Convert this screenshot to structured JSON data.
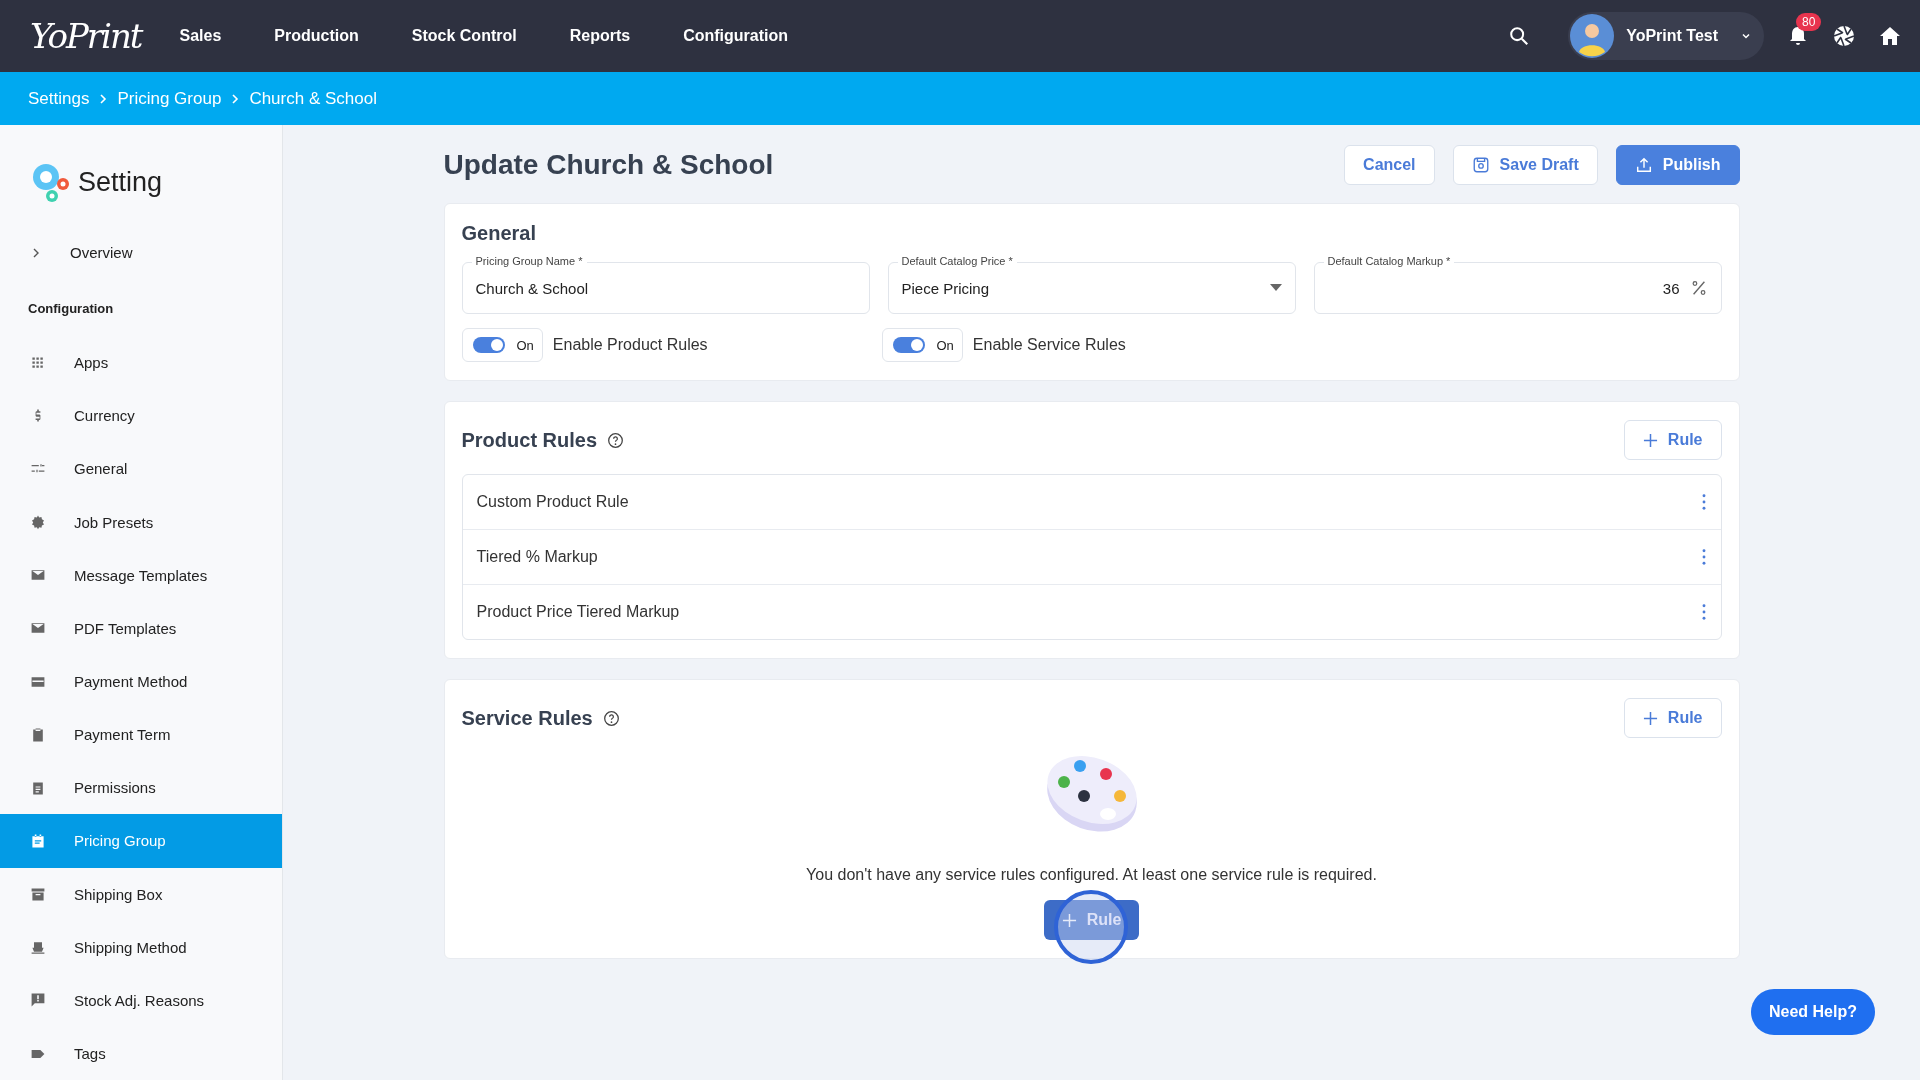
{
  "topbar": {
    "logo": "YoPrint",
    "nav": [
      {
        "label": "Sales"
      },
      {
        "label": "Production"
      },
      {
        "label": "Stock Control"
      },
      {
        "label": "Reports"
      },
      {
        "label": "Configuration"
      }
    ],
    "user": "YoPrint Test",
    "notifications": "80"
  },
  "breadcrumb": [
    "Settings",
    "Pricing Group",
    "Church & School"
  ],
  "sidebar": {
    "title": "Setting",
    "overview": "Overview",
    "section": "Configuration",
    "items": [
      {
        "label": "Apps",
        "selected": false
      },
      {
        "label": "Currency",
        "selected": false
      },
      {
        "label": "General",
        "selected": false
      },
      {
        "label": "Job Presets",
        "selected": false
      },
      {
        "label": "Message Templates",
        "selected": false
      },
      {
        "label": "PDF Templates",
        "selected": false
      },
      {
        "label": "Payment Method",
        "selected": false
      },
      {
        "label": "Payment Term",
        "selected": false
      },
      {
        "label": "Permissions",
        "selected": false
      },
      {
        "label": "Pricing Group",
        "selected": true
      },
      {
        "label": "Shipping Box",
        "selected": false
      },
      {
        "label": "Shipping Method",
        "selected": false
      },
      {
        "label": "Stock Adj. Reasons",
        "selected": false
      },
      {
        "label": "Tags",
        "selected": false
      }
    ]
  },
  "page": {
    "title": "Update Church & School",
    "buttons": [
      {
        "label": "Cancel",
        "kind": "cancel"
      },
      {
        "label": "Save Draft",
        "kind": "draft"
      },
      {
        "label": "Publish",
        "kind": "publish"
      }
    ]
  },
  "general": {
    "title": "General",
    "fields": [
      {
        "kind": "text",
        "label": "Pricing Group Name *",
        "value": "Church & School"
      },
      {
        "kind": "select",
        "label": "Default Catalog Price *",
        "value": "Piece Pricing"
      },
      {
        "kind": "percent",
        "label": "Default Catalog Markup *",
        "value": "36"
      }
    ],
    "toggles": [
      {
        "state": "On",
        "on": true,
        "label": "Enable Product Rules"
      },
      {
        "state": "On",
        "on": true,
        "label": "Enable Service Rules"
      }
    ]
  },
  "product_rules": {
    "title": "Product Rules",
    "add": "Rule",
    "rules": [
      "Custom Product Rule",
      "Tiered % Markup",
      "Product Price Tiered Markup"
    ]
  },
  "service_rules": {
    "title": "Service Rules",
    "add": "Rule",
    "empty": "You don't have any service rules configured. At least one service rule is required.",
    "empty_button": "Rule"
  },
  "help": "Need Help?"
}
